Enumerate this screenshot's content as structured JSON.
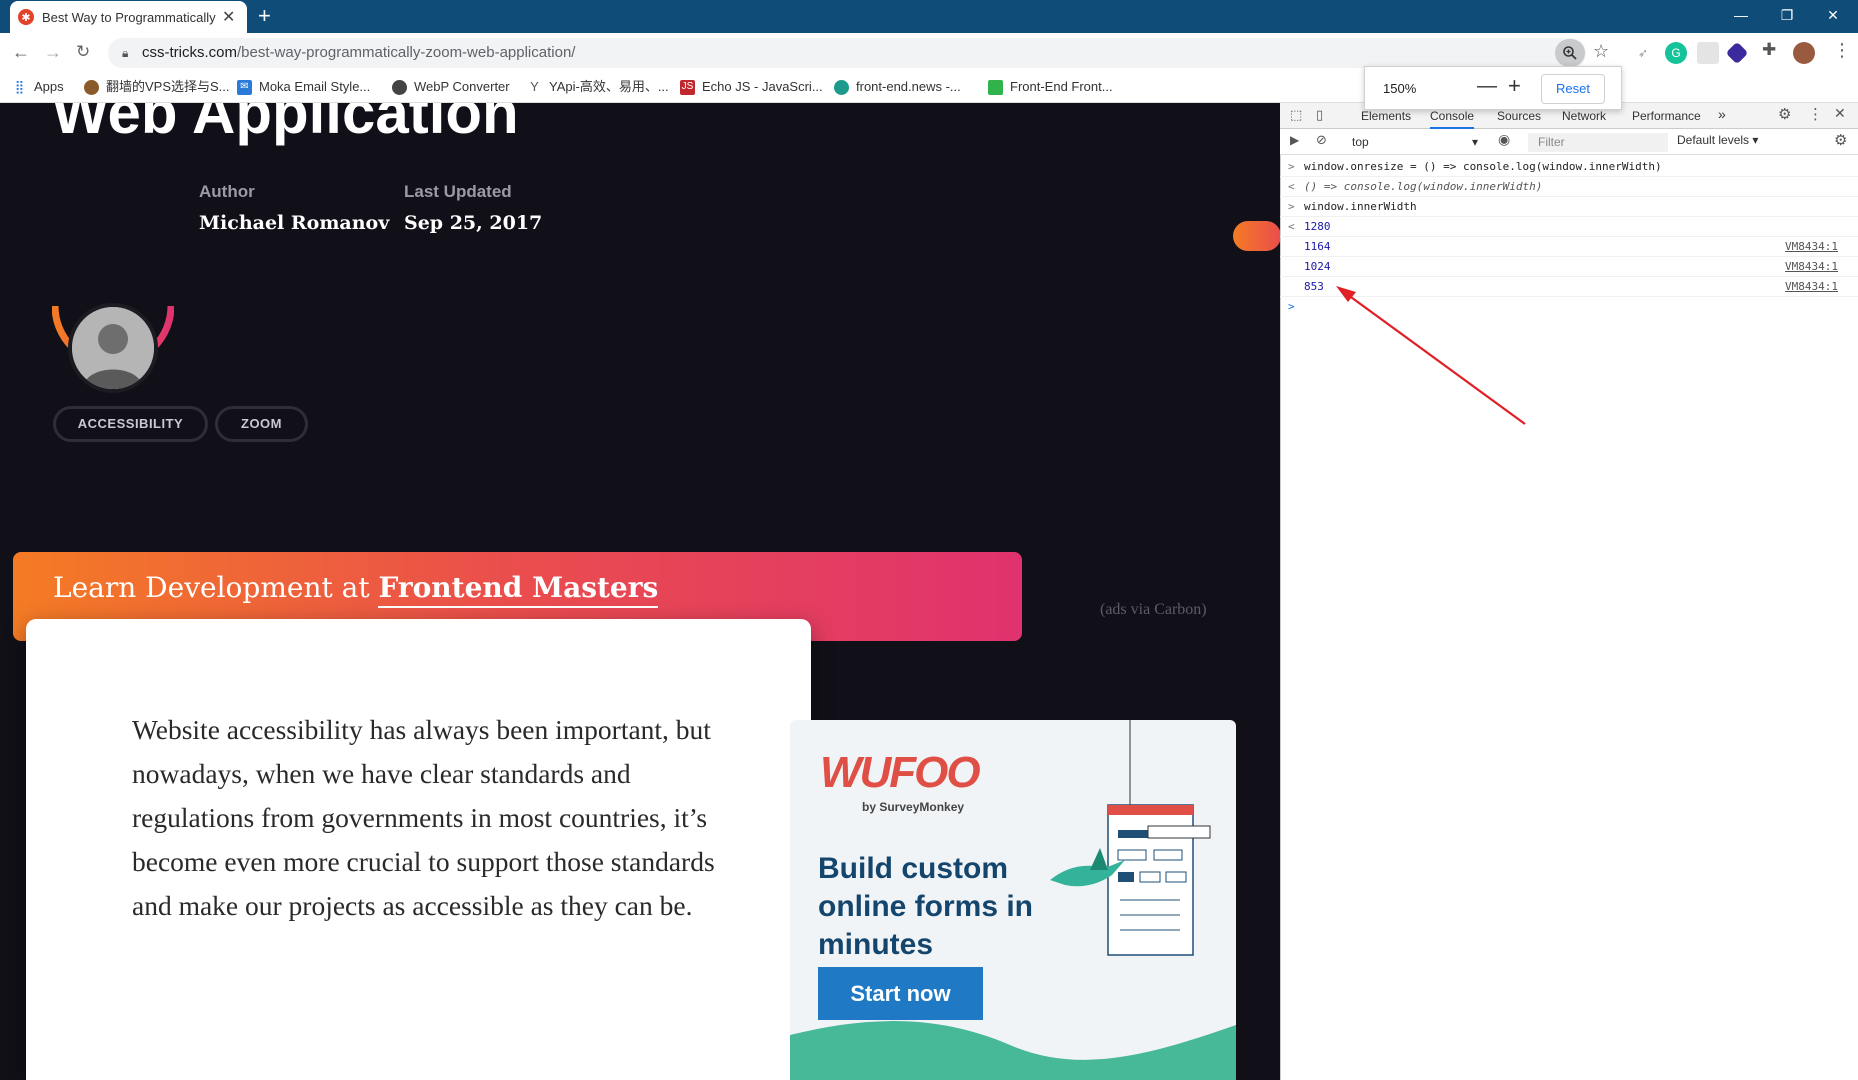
{
  "browser": {
    "tab_title": "Best Way to Programmatically Zoom a Web Application",
    "tab_favicon": "css-tricks-star-icon",
    "url_domain": "css-tricks.com",
    "url_path": "/best-way-programmatically-zoom-web-application/",
    "bookmarks": [
      {
        "label": "Apps",
        "icon": "apps-grid-icon"
      },
      {
        "label": "翻墙的VPS选择与S...",
        "icon": "globe-icon"
      },
      {
        "label": "Moka Email Style...",
        "icon": "mail-icon"
      },
      {
        "label": "WebP Converter",
        "icon": "webp-icon"
      },
      {
        "label": "YApi-高效、易用、...",
        "icon": "yapi-icon"
      },
      {
        "label": "Echo JS - JavaScri...",
        "icon": "js-icon"
      },
      {
        "label": "front-end.news -...",
        "icon": "news-icon"
      },
      {
        "label": "Front-End Front...",
        "icon": "frontend-icon"
      }
    ],
    "zoom_popup": {
      "percent": "150%",
      "minus": "—",
      "plus": "+",
      "reset": "Reset"
    }
  },
  "page": {
    "title": "Web Application",
    "author_label": "Author",
    "author_name": "Michael Romanov",
    "updated_label": "Last Updated",
    "updated_date": "Sep 25, 2017",
    "tags": [
      "ACCESSIBILITY",
      "ZOOM"
    ],
    "promo_prefix": "Learn Development at ",
    "promo_brand": "Frontend Masters",
    "carbon_note": "(ads via Carbon)",
    "body_text": "Website accessibility has always been important, but nowadays, when we have clear standards and regulations from governments in most countries, it’s become even more crucial to support those standards and make our projects as accessible as they can be.",
    "ad": {
      "logo": "WUFOO",
      "by": "by SurveyMonkey",
      "headline": "Build custom online forms in minutes",
      "button": "Start now"
    }
  },
  "devtools": {
    "tabs": [
      "Elements",
      "Console",
      "Sources",
      "Network",
      "Performance"
    ],
    "more": "»",
    "context": "top",
    "filter_placeholder": "Filter",
    "levels": "Default levels ▾",
    "lines": [
      {
        "prompt": ">",
        "text": "window.onresize = () => console.log(window.innerWidth)",
        "kind": "input",
        "src": ""
      },
      {
        "prompt": "<",
        "text": "() => console.log(window.innerWidth)",
        "kind": "result-fn",
        "src": ""
      },
      {
        "prompt": ">",
        "text": "window.innerWidth",
        "kind": "input",
        "src": ""
      },
      {
        "prompt": "<",
        "text": "1280",
        "kind": "result-num",
        "src": ""
      },
      {
        "prompt": "",
        "text": "1164",
        "kind": "log-num",
        "src": "VM8434:1"
      },
      {
        "prompt": "",
        "text": "1024",
        "kind": "log-num",
        "src": "VM8434:1"
      },
      {
        "prompt": "",
        "text": "853",
        "kind": "log-num",
        "src": "VM8434:1"
      }
    ],
    "caret": ">"
  }
}
